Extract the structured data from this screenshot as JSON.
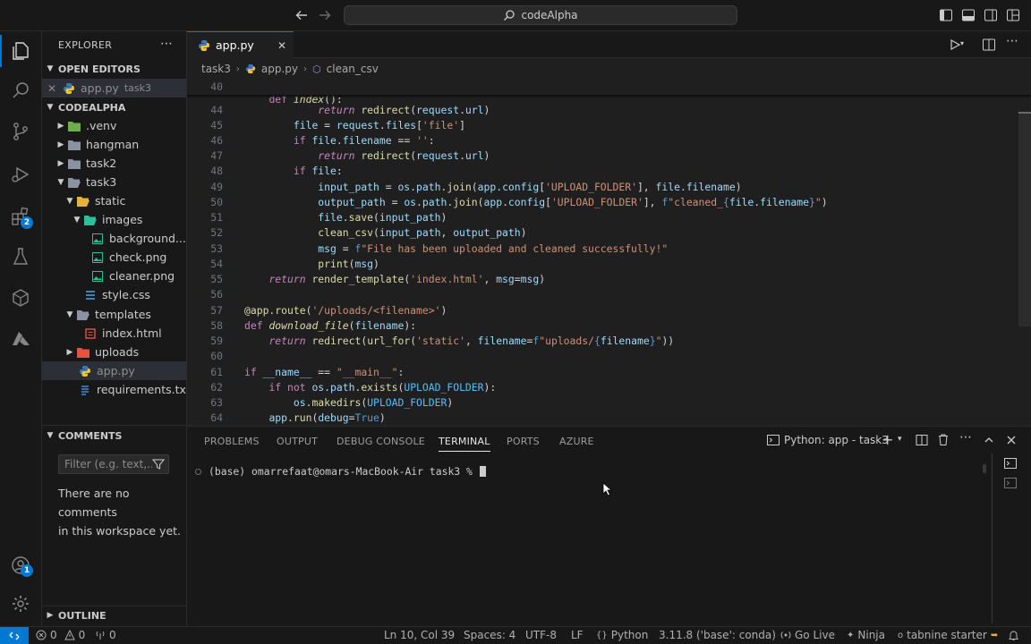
{
  "titlebar": {
    "search_text": "codeAlpha"
  },
  "activity": {
    "extensions_badge": "2",
    "accounts_badge": "1"
  },
  "sidebar": {
    "explorer_title": "EXPLORER",
    "open_editors_title": "OPEN EDITORS",
    "open_editor": {
      "name": "app.py",
      "folder": "task3"
    },
    "workspace_title": "CODEALPHA",
    "tree": [
      {
        "label": ".venv"
      },
      {
        "label": "hangman"
      },
      {
        "label": "task2"
      },
      {
        "label": "task3"
      },
      {
        "label": "static"
      },
      {
        "label": "images"
      },
      {
        "label": "background..."
      },
      {
        "label": "check.png"
      },
      {
        "label": "cleaner.png"
      },
      {
        "label": "style.css"
      },
      {
        "label": "templates"
      },
      {
        "label": "index.html"
      },
      {
        "label": "uploads"
      },
      {
        "label": "app.py"
      },
      {
        "label": "requirements.txt"
      }
    ],
    "comments_title": "COMMENTS",
    "filter_placeholder": "Filter (e.g. text,...",
    "no_comments_line1": "There are no comments",
    "no_comments_line2": "in this workspace yet.",
    "outline_title": "OUTLINE"
  },
  "editor": {
    "tab_label": "app.py",
    "breadcrumb": [
      "task3",
      "app.py",
      "clean_csv"
    ],
    "sticky_line": {
      "no": "40",
      "text": "def index():"
    },
    "lines": [
      {
        "no": "44",
        "text": "            return redirect(request.url)"
      },
      {
        "no": "45",
        "text": "        file = request.files['file']"
      },
      {
        "no": "46",
        "text": "        if file.filename == '':"
      },
      {
        "no": "47",
        "text": "            return redirect(request.url)"
      },
      {
        "no": "48",
        "text": "        if file:"
      },
      {
        "no": "49",
        "text": "            input_path = os.path.join(app.config['UPLOAD_FOLDER'], file.filename)"
      },
      {
        "no": "50",
        "text": "            output_path = os.path.join(app.config['UPLOAD_FOLDER'], f\"cleaned_{file.filename}\")"
      },
      {
        "no": "51",
        "text": "            file.save(input_path)"
      },
      {
        "no": "52",
        "text": "            clean_csv(input_path, output_path)"
      },
      {
        "no": "53",
        "text": "            msg = f\"File has been uploaded and cleaned successfully!\""
      },
      {
        "no": "54",
        "text": "            print(msg)"
      },
      {
        "no": "55",
        "text": "    return render_template('index.html', msg=msg)"
      },
      {
        "no": "56",
        "text": ""
      },
      {
        "no": "57",
        "text": "@app.route('/uploads/<filename>')"
      },
      {
        "no": "58",
        "text": "def download_file(filename):"
      },
      {
        "no": "59",
        "text": "    return redirect(url_for('static', filename=f\"uploads/{filename}\"))"
      },
      {
        "no": "60",
        "text": ""
      },
      {
        "no": "61",
        "text": "if __name__ == \"__main__\":"
      },
      {
        "no": "62",
        "text": "    if not os.path.exists(UPLOAD_FOLDER):"
      },
      {
        "no": "63",
        "text": "        os.makedirs(UPLOAD_FOLDER)"
      },
      {
        "no": "64",
        "text": "    app.run(debug=True)"
      }
    ]
  },
  "panel": {
    "tabs": [
      "PROBLEMS",
      "OUTPUT",
      "DEBUG CONSOLE",
      "TERMINAL",
      "PORTS",
      "AZURE"
    ],
    "active_tab": "TERMINAL",
    "terminal_title": "Python: app - task3",
    "prompt": "(base) omarrefaat@omars-MacBook-Air task3 %"
  },
  "status": {
    "errors": "0",
    "warnings": "0",
    "ports": "0",
    "cursor": "Ln 10, Col 39",
    "spaces": "Spaces: 4",
    "encoding": "UTF-8",
    "eol": "LF",
    "language": "Python",
    "interpreter": "3.11.8 ('base': conda)",
    "golive": "Go Live",
    "ninja": "Ninja",
    "tabnine": "tabnine starter"
  },
  "colors": {
    "accent": "#0078d4",
    "background": "#1f1f1f",
    "chrome": "#181818"
  }
}
